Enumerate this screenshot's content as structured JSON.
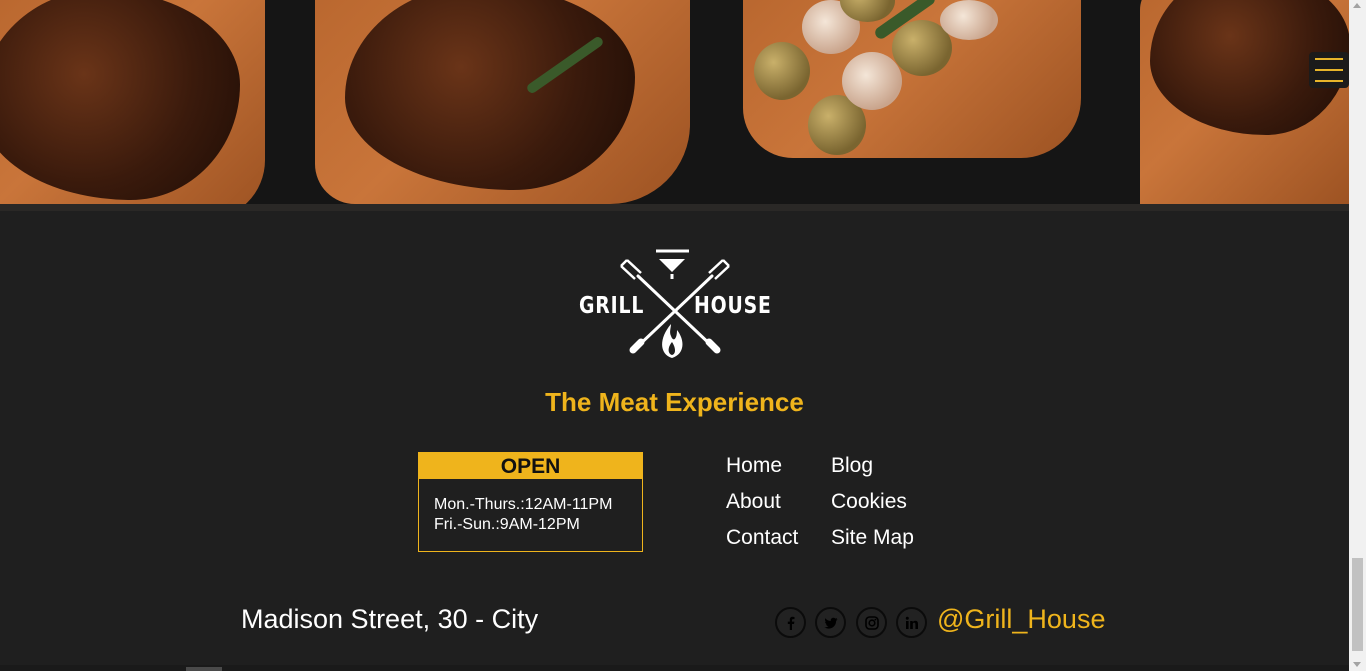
{
  "hero": {
    "icons": [
      "grilled-steak-image",
      "potato-skewer-image"
    ]
  },
  "menu": {
    "icon": "hamburger-menu-icon"
  },
  "brand": {
    "logo_left": "GRILL",
    "logo_right": "HOUSE",
    "logo_icon": "crossed-forks-fire-logo"
  },
  "tagline": "The Meat Experience",
  "hours": {
    "title": "OPEN",
    "lines": [
      "Mon.-Thurs.:12AM-11PM",
      "Fri.-Sun.:9AM-12PM"
    ]
  },
  "nav": {
    "col1": [
      "Home",
      "About",
      "Contact"
    ],
    "col2": [
      "Blog",
      "Cookies",
      "Site Map"
    ]
  },
  "footer": {
    "address": "Madison Street, 30 - City",
    "social": [
      "facebook-icon",
      "twitter-icon",
      "instagram-icon",
      "linkedin-icon"
    ],
    "handle": "@Grill_House"
  },
  "colors": {
    "accent": "#efb41c",
    "background": "#1f1f1f",
    "text": "#ffffff"
  }
}
